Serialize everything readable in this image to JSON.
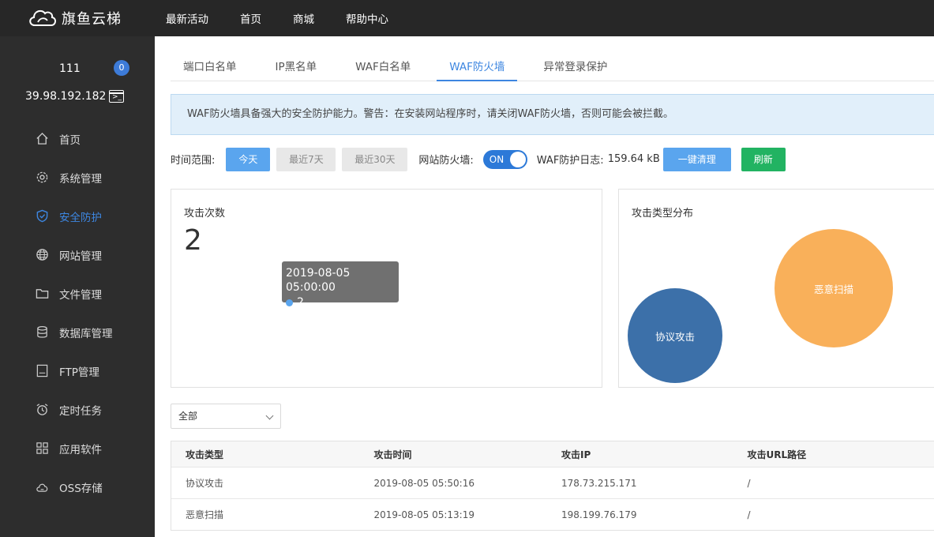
{
  "app": {
    "brand": "旗鱼云梯"
  },
  "topnav": {
    "items": [
      "最新活动",
      "首页",
      "商城",
      "帮助中心"
    ]
  },
  "user": {
    "name": "111",
    "badge_count": "0",
    "ip": "39.98.192.182"
  },
  "sidebar": {
    "items": [
      {
        "label": "首页",
        "icon": "home-icon"
      },
      {
        "label": "系统管理",
        "icon": "gear-icon"
      },
      {
        "label": "安全防护",
        "icon": "shield-icon"
      },
      {
        "label": "网站管理",
        "icon": "globe-icon"
      },
      {
        "label": "文件管理",
        "icon": "folder-icon"
      },
      {
        "label": "数据库管理",
        "icon": "database-icon"
      },
      {
        "label": "FTP管理",
        "icon": "ftp-icon"
      },
      {
        "label": "定时任务",
        "icon": "alarm-clock-icon"
      },
      {
        "label": "应用软件",
        "icon": "apps-grid-icon"
      },
      {
        "label": "OSS存储",
        "icon": "cloud-storage-icon"
      }
    ],
    "active": "安全防护"
  },
  "tabs": {
    "items": [
      "端口白名单",
      "IP黑名单",
      "WAF白名单",
      "WAF防火墙",
      "异常登录保护"
    ],
    "active": "WAF防火墙"
  },
  "notice": {
    "text": "WAF防火墙具备强大的安全防护能力。警告：在安装网站程序时，请关闭WAF防火墙，否则可能会被拦截。"
  },
  "toolbar": {
    "time_range_label": "时间范围:",
    "ranges": [
      "今天",
      "最近7天",
      "最近30天"
    ],
    "active_range": "今天",
    "firewall_label": "网站防火墙:",
    "toggle_text": "ON",
    "log_label": "WAF防护日志:",
    "log_size": "159.64 kB",
    "clean_button": "一键清理",
    "refresh_button": "刷新"
  },
  "attack_card": {
    "title": "攻击次数",
    "count": "2",
    "tooltip": {
      "date": "2019-08-05 05:00:00",
      "value": "2"
    }
  },
  "distribution_card": {
    "title": "攻击类型分布"
  },
  "chart_data": {
    "type": "bubble",
    "series": [
      {
        "name": "协议攻击",
        "value": 1,
        "color": "#3c70a9"
      },
      {
        "name": "恶意扫描",
        "value": 1,
        "color": "#f9b05a"
      }
    ]
  },
  "filter": {
    "selected": "全部"
  },
  "table": {
    "headers": [
      "攻击类型",
      "攻击时间",
      "攻击IP",
      "攻击URL路径"
    ],
    "rows": [
      [
        "协议攻击",
        "2019-08-05 05:50:16",
        "178.73.215.171",
        "/"
      ],
      [
        "恶意扫描",
        "2019-08-05 05:13:19",
        "198.199.76.179",
        "/"
      ]
    ]
  },
  "colors": {
    "accent": "#3d86e0",
    "topbar": "#272727",
    "sidebar": "#2d2d2d",
    "refresh": "#22b362"
  }
}
